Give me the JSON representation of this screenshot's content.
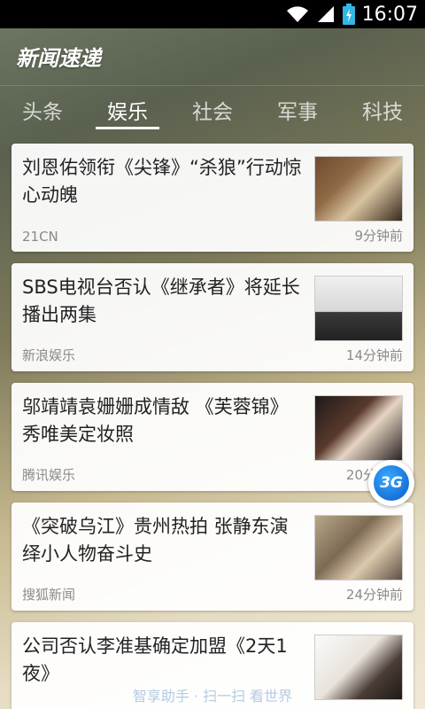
{
  "status_bar": {
    "time": "16:07",
    "icons": [
      "wifi-icon",
      "signal-icon",
      "battery-icon"
    ]
  },
  "app_bar": {
    "title": "新闻速递"
  },
  "tabs": [
    {
      "label": "头条",
      "active": false
    },
    {
      "label": "娱乐",
      "active": true
    },
    {
      "label": "社会",
      "active": false
    },
    {
      "label": "军事",
      "active": false
    },
    {
      "label": "科技",
      "active": false
    }
  ],
  "news": [
    {
      "title": "刘恩佑领衔《尖锋》“杀狼”行动惊心动魄",
      "source": "21CN",
      "time": "9分钟前"
    },
    {
      "title": "SBS电视台否认《继承者》将延长播出两集",
      "source": "新浪娱乐",
      "time": "14分钟前"
    },
    {
      "title": "邬靖靖袁姗姗成情敌 《芙蓉锦》秀唯美定妆照",
      "source": "腾讯娱乐",
      "time": "20分钟前"
    },
    {
      "title": "《突破乌江》贵州热拍 张静东演绎小人物奋斗史",
      "source": "搜狐新闻",
      "time": "24分钟前"
    },
    {
      "title": "公司否认李准基确定加盟《2天1夜》",
      "source": "",
      "time": ""
    }
  ],
  "fab": {
    "label": "3G"
  },
  "watermark": {
    "text": "智享助手 · 扫一扫 看世界"
  }
}
